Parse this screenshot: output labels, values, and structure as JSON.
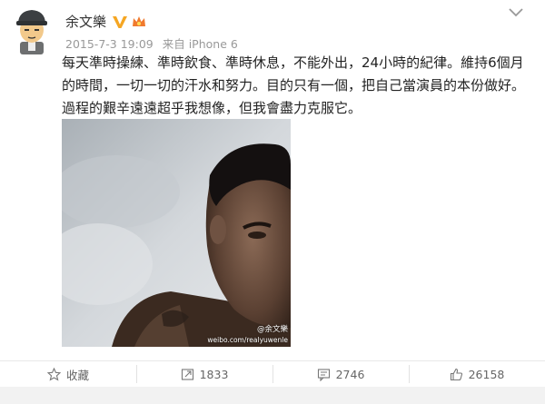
{
  "post": {
    "author": "余文樂",
    "date": "2015-7-3 19:09",
    "source": "来自 iPhone 6",
    "text": "每天準時操練、準時飲食、準時休息，不能外出，24小時的紀律。維持6個月的時間，一切一切的汗水和努力。目的只有一個，把自己當演員的本份做好。過程的艱辛遠遠超乎我想像，但我會盡力克服它。",
    "photo": {
      "watermark": "@余文樂",
      "watermark_url": "weibo.com/realyuwenle"
    }
  },
  "actions": {
    "favorite": {
      "label": "收藏",
      "icon": "star-icon"
    },
    "repost": {
      "label": "1833",
      "icon": "repost-icon"
    },
    "comment": {
      "label": "2746",
      "icon": "comment-icon"
    },
    "like": {
      "label": "26158",
      "icon": "thumbs-up-icon"
    }
  },
  "colors": {
    "meta_gray": "#999999",
    "verified_gold": "#f5a623",
    "action_text": "#666666"
  }
}
